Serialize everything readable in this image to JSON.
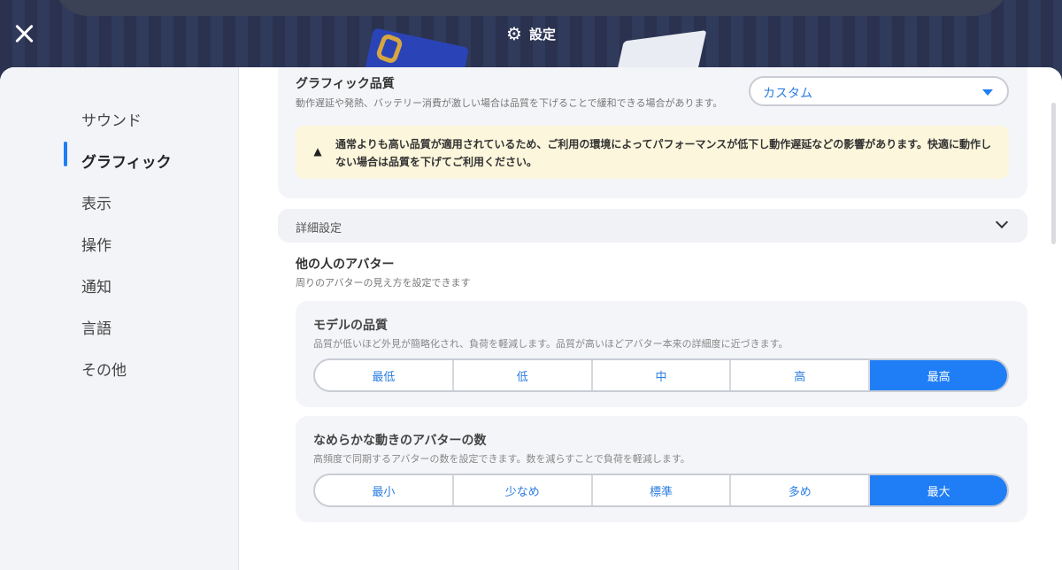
{
  "header": {
    "title": "設定",
    "icon": "gear-icon",
    "close_icon": "close-icon"
  },
  "sidebar": {
    "items": [
      {
        "label": "サウンド"
      },
      {
        "label": "グラフィック",
        "active": true
      },
      {
        "label": "表示"
      },
      {
        "label": "操作"
      },
      {
        "label": "通知"
      },
      {
        "label": "言語"
      },
      {
        "label": "その他"
      }
    ]
  },
  "graphics_quality": {
    "title": "グラフィック品質",
    "description": "動作遅延や発熱、バッテリー消費が激しい場合は品質を下げることで緩和できる場合があります。",
    "selected": "カスタム",
    "warning": "通常よりも高い品質が適用されているため、ご利用の環境によってパフォーマンスが低下し動作遅延などの影響があります。快適に動作しない場合は品質を下げてご利用ください。"
  },
  "details": {
    "label": "詳細設定"
  },
  "others_avatar": {
    "title": "他の人のアバター",
    "description": "周りのアバターの見え方を設定できます"
  },
  "model_quality": {
    "title": "モデルの品質",
    "description": "品質が低いほど外見が簡略化され、負荷を軽減します。品質が高いほどアバター本来の詳細度に近づきます。",
    "options": [
      "最低",
      "低",
      "中",
      "高",
      "最高"
    ],
    "selected": "最高"
  },
  "smooth_avatars": {
    "title": "なめらかな動きのアバターの数",
    "description": "高頻度で同期するアバターの数を設定できます。数を減らすことで負荷を軽減します。",
    "options": [
      "最小",
      "少なめ",
      "標準",
      "多め",
      "最大"
    ],
    "selected": "最大"
  },
  "colors": {
    "accent": "#1f7ef5",
    "warning_bg": "#fcf6dc"
  }
}
